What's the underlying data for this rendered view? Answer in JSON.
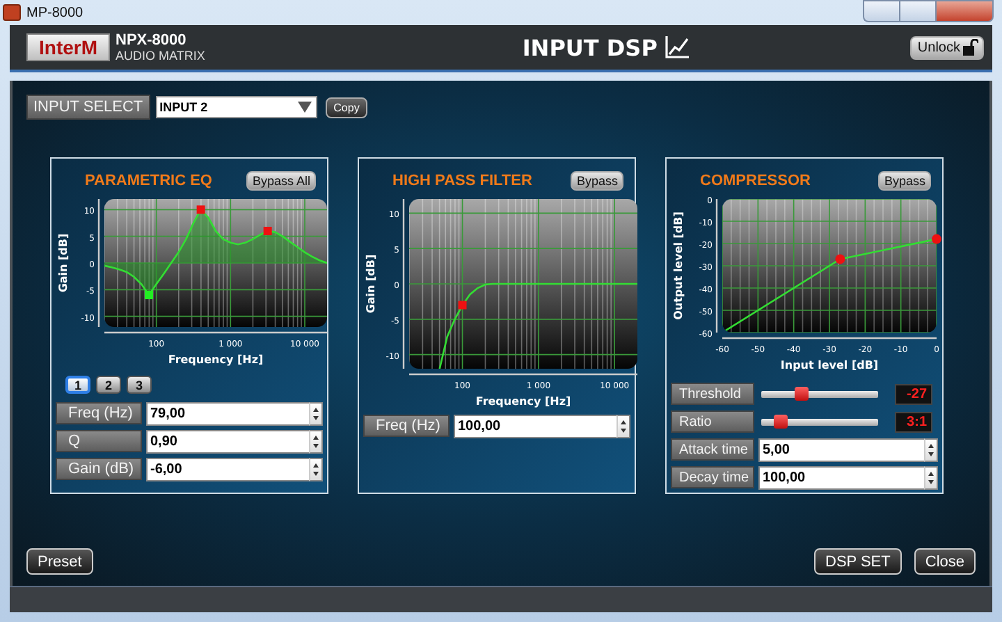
{
  "window": {
    "title": "MP-8000"
  },
  "header": {
    "logo": "InterM",
    "product": "NPX-8000",
    "subtitle": "AUDIO MATRIX",
    "title": "INPUT DSP",
    "unlock_button": "Unlock"
  },
  "input_select": {
    "label": "INPUT SELECT",
    "value": "INPUT 2",
    "copy_button": "Copy"
  },
  "panels": [
    {
      "kind": "eq",
      "title": "PARAMETRIC EQ",
      "bypass_button": "Bypass All",
      "chart_data": {
        "type": "area",
        "xlabel": "Frequency [Hz]",
        "ylabel": "Gain [dB]",
        "grid": true,
        "categories": [
          null,
          null,
          null,
          null,
          null,
          null,
          null,
          "100",
          null,
          null,
          null,
          null,
          null,
          null,
          null,
          null,
          null,
          "1 000",
          null,
          null,
          null,
          null,
          null,
          null,
          null,
          null,
          null,
          "10 000",
          null,
          null,
          null
        ],
        "series": [
          {
            "color": "#33dd33",
            "values": [
              -0.5,
              -0.8,
              -1.2,
              -1.7,
              -2.6,
              -4,
              -6,
              -4,
              -2,
              0,
              2,
              4.5,
              7.5,
              10,
              8.5,
              6,
              4.5,
              3.8,
              3.5,
              3.8,
              4.5,
              5.3,
              6,
              5.8,
              5,
              4,
              3,
              2,
              1.2,
              0.5,
              0
            ]
          },
          {
            "type": "scatter",
            "color": "#22ee22",
            "values": [
              null,
              null,
              null,
              null,
              null,
              null,
              -6,
              null,
              null,
              null,
              null,
              null,
              null,
              null,
              null,
              null,
              null,
              null,
              null,
              null,
              null,
              null,
              null,
              null,
              null,
              null,
              null,
              null,
              null,
              null,
              null
            ]
          },
          {
            "type": "scatter",
            "color": "#ee1111",
            "values": [
              null,
              null,
              null,
              null,
              null,
              null,
              null,
              null,
              null,
              null,
              null,
              null,
              null,
              10,
              null,
              null,
              null,
              null,
              null,
              null,
              null,
              null,
              6,
              null,
              null,
              null,
              null,
              null,
              null,
              null,
              null
            ]
          }
        ],
        "ylim": [
          -12,
          12
        ],
        "yticks": [
          -10,
          -5,
          0,
          5,
          10
        ]
      },
      "bands": [
        {
          "label": "1",
          "selected": true
        },
        {
          "label": "2",
          "selected": false
        },
        {
          "label": "3",
          "selected": false
        }
      ],
      "rows": [
        {
          "kind": "field",
          "label": "Freq (Hz)",
          "value": "79,00"
        },
        {
          "kind": "field",
          "label": "Q",
          "value": "0,90"
        },
        {
          "kind": "field",
          "label": "Gain (dB)",
          "value": "-6,00"
        }
      ]
    },
    {
      "kind": "hpf",
      "title": "HIGH PASS FILTER",
      "bypass_button": "Bypass",
      "chart_data": {
        "type": "line",
        "xlabel": "Frequency [Hz]",
        "ylabel": "Gain [dB]",
        "grid": true,
        "categories": [
          null,
          null,
          null,
          null,
          null,
          null,
          null,
          "100",
          null,
          null,
          null,
          null,
          null,
          null,
          null,
          null,
          null,
          "1 000",
          null,
          null,
          null,
          null,
          null,
          null,
          null,
          null,
          null,
          "10 000",
          null,
          null,
          null
        ],
        "series": [
          {
            "color": "#33dd33",
            "values": [
              null,
              null,
              null,
              null,
              -12,
              -7.5,
              -5,
              -3,
              -1.5,
              -0.6,
              -0.1,
              0,
              0,
              0,
              0,
              0,
              0,
              0,
              0,
              0,
              0,
              0,
              0,
              0,
              0,
              0,
              0,
              0,
              0,
              0,
              0
            ]
          },
          {
            "type": "scatter",
            "color": "#ee1111",
            "values": [
              null,
              null,
              null,
              null,
              null,
              null,
              null,
              -3,
              null,
              null,
              null,
              null,
              null,
              null,
              null,
              null,
              null,
              null,
              null,
              null,
              null,
              null,
              null,
              null,
              null,
              null,
              null,
              null,
              null,
              null,
              null
            ]
          }
        ],
        "ylim": [
          -12,
          12
        ],
        "yticks": [
          -10,
          -5,
          0,
          5,
          10
        ]
      },
      "rows": [
        {
          "kind": "field",
          "label": "Freq (Hz)",
          "value": "100,00"
        }
      ]
    },
    {
      "kind": "compressor",
      "title": "COMPRESSOR",
      "bypass_button": "Bypass",
      "chart_data": {
        "type": "line",
        "xlabel": "Input level [dB]",
        "ylabel": "Output level [dB]",
        "grid": true,
        "x": [
          -60,
          -27,
          0
        ],
        "series": [
          {
            "color": "#33dd33",
            "values": [
              -60,
              -27,
              -18
            ]
          },
          {
            "type": "scatter",
            "color": "#ee1111",
            "values": [
              null,
              -27,
              -18
            ]
          }
        ],
        "xlim": [
          -60,
          0
        ],
        "ylim": [
          -60,
          0
        ],
        "xticks": [
          -60,
          -50,
          -40,
          -30,
          -20,
          -10,
          0
        ],
        "yticks": [
          -60,
          -50,
          -40,
          -30,
          -20,
          -10,
          0
        ]
      },
      "rows": [
        {
          "kind": "slider",
          "label": "Threshold",
          "level": 0.35,
          "reading": "-27"
        },
        {
          "kind": "slider",
          "label": "Ratio",
          "level": 0.17,
          "reading": "3:1"
        },
        {
          "kind": "field",
          "label": "Attack time",
          "value": "5,00"
        },
        {
          "kind": "field",
          "label": "Decay time",
          "value": "100,00"
        }
      ]
    }
  ],
  "footer": {
    "preset_button": "Preset",
    "dsp_set_button": "DSP SET",
    "close_button": "Close"
  }
}
